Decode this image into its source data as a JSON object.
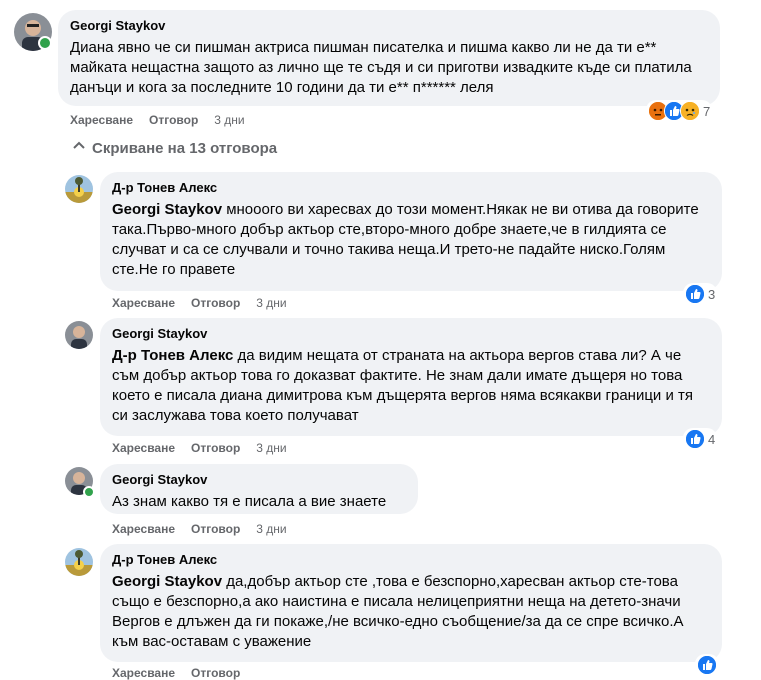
{
  "comments": [
    {
      "author": "Georgi Staykov",
      "mention": "",
      "text": "Диана явно че си пишман актриса пишман писателка и пишма какво ли не да ти е** майката нещастна защото аз лично ще те съдя и си приготви извадките къде си платила данъци и кога за последните 10 години да ти е** п****** леля",
      "like": "Харесване",
      "reply": "Отговор",
      "time": "3 дни",
      "reactions": "7"
    },
    {
      "author": "Д-р Тонев Алекс",
      "mention": "Georgi Staykov",
      "text": " мнооого ви харесвах до този момент.Някак не ви отива да говорите така.Първо-много добър актьор сте,второ-много добре знаете,че в гилдията се случват и са се случвали и точно такива неща.И трето-не падайте ниско.Голям сте.Не го правете",
      "like": "Харесване",
      "reply": "Отговор",
      "time": "3 дни",
      "reactions": "3"
    },
    {
      "author": "Georgi Staykov",
      "mention": "Д-р Тонев Алекс",
      "text": " да видим нещата от страната на актьора вергов става ли? А че съм добър актьор това го доказват фактите. Не знам дали имате дъщеря но това което е писала диана димитрова към дъщерята вергов няма всякакви граници и тя си заслужава това което получават",
      "like": "Харесване",
      "reply": "Отговор",
      "time": "3 дни",
      "reactions": "4"
    },
    {
      "author": "Georgi Staykov",
      "mention": "",
      "text": "Аз знам какво тя е писала а вие знаете",
      "like": "Харесване",
      "reply": "Отговор",
      "time": "3 дни",
      "reactions": ""
    },
    {
      "author": "Д-р Тонев Алекс",
      "mention": "Georgi Staykov",
      "text": " да,добър актьор сте ,това е безспорно,харесван актьор сте-това също е безспорно,а ако наистина е писала нелицеприятни неща на детето-значи Вергов е длъжен да ги покаже,/не всичко-едно съобщение/за да се спре всичко.А към вас-оставам с уважение",
      "like": "Харесване",
      "reply": "Отговор",
      "time": "",
      "reactions": ""
    }
  ],
  "hide_replies": "Скриване на 13 отговора",
  "colors": {
    "bubble": "#f0f2f5",
    "like": "#1877f2",
    "online": "#31a24c",
    "meta": "#65676b"
  }
}
